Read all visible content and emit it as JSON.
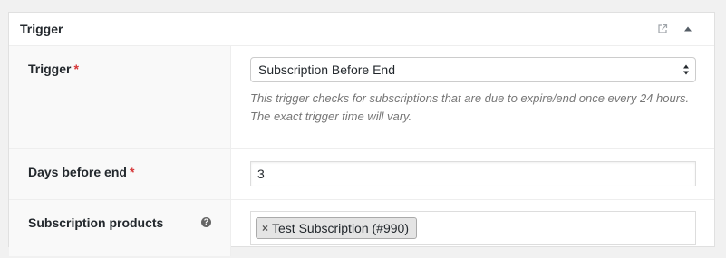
{
  "panel": {
    "title": "Trigger",
    "header_icons": [
      "external-link-icon",
      "collapse-arrow-icon"
    ]
  },
  "fields": {
    "trigger": {
      "label": "Trigger",
      "required_marker": "*",
      "value": "Subscription Before End",
      "description": "This trigger checks for subscriptions that are due to expire/end once every 24 hours. The exact trigger time will vary."
    },
    "days_before_end": {
      "label": "Days before end",
      "required_marker": "*",
      "value": "3"
    },
    "subscription_products": {
      "label": "Subscription products",
      "help_icon": "?",
      "selected": [
        {
          "remove": "×",
          "label": "Test Subscription (#990)"
        }
      ]
    }
  },
  "colors": {
    "required": "#d63638",
    "description_text": "#777777",
    "label_background": "#f9f9f9"
  }
}
